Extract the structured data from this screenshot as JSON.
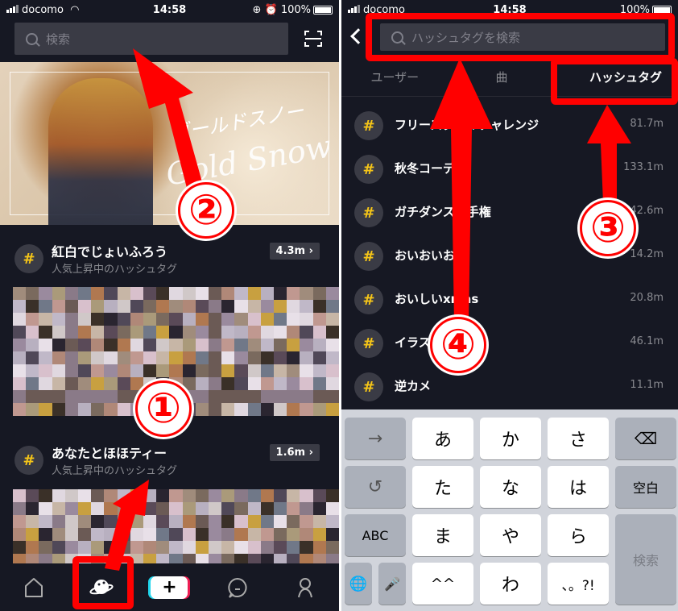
{
  "status_bar": {
    "carrier": "docomo",
    "time": "14:58",
    "battery": "100%"
  },
  "left": {
    "search": {
      "placeholder": "検索",
      "icon": "search-icon"
    },
    "scan_icon": "scan-icon",
    "banner": {
      "text_jp": "ゴールドスノー",
      "text_en": "Gold Snow"
    },
    "trending": [
      {
        "title": "紅白でじょいふろう",
        "subtitle": "人気上昇中のハッシュタグ",
        "count": "4.3m",
        "chevron": "›"
      },
      {
        "title": "あなたとほほティー",
        "subtitle": "人気上昇中のハッシュタグ",
        "count": "1.6m",
        "chevron": "›"
      }
    ],
    "tabbar": [
      {
        "name": "home",
        "icon": "home-icon"
      },
      {
        "name": "discover",
        "icon": "planet-icon"
      },
      {
        "name": "create",
        "icon": "plus-icon",
        "label": "+"
      },
      {
        "name": "inbox",
        "icon": "chat-icon"
      },
      {
        "name": "profile",
        "icon": "profile-icon"
      }
    ]
  },
  "right": {
    "search": {
      "placeholder": "ハッシュタグを検索"
    },
    "tabs": [
      {
        "label": "ユーザー",
        "active": false
      },
      {
        "label": "曲",
        "active": false
      },
      {
        "label": "ハッシュタグ",
        "active": true
      }
    ],
    "hashtags": [
      {
        "name": "フリースタイルチャレンジ",
        "visible_name": "フリース　　レンジ",
        "count": "81.7m"
      },
      {
        "name": "秋冬コーデ",
        "visible_name": "秋冬コー",
        "count": "133.1m"
      },
      {
        "name": "ガチダンス選手権",
        "visible_name": "ガチダン　選手権",
        "count": "42.6m"
      },
      {
        "name": "おいおいおい",
        "visible_name": "おいおいおい",
        "count": "14.2m"
      },
      {
        "name": "おいしいxmas",
        "visible_name": "おいしいxmas",
        "count": "20.8m"
      },
      {
        "name": "イラスト",
        "visible_name": "イラス",
        "count": "46.1m"
      },
      {
        "name": "逆カメ",
        "visible_name": "逆カメ",
        "count": "11.1m"
      }
    ],
    "keyboard": {
      "rows": [
        [
          "→",
          "あ",
          "か",
          "さ",
          "⌫"
        ],
        [
          "↺",
          "た",
          "な",
          "は",
          "空白"
        ],
        [
          "ABC",
          "ま",
          "や",
          "ら",
          "検索"
        ],
        [
          "🌐",
          "🎤",
          "^^",
          "わ",
          "、。?!"
        ]
      ],
      "search_key": "検索",
      "space_key": "空白"
    }
  },
  "hash_symbol": "#",
  "annotations": [
    {
      "number": "①",
      "target": "discover-tab"
    },
    {
      "number": "②",
      "target": "search-bar"
    },
    {
      "number": "③",
      "target": "hashtag-tab"
    },
    {
      "number": "④",
      "target": "hashtag-search-input"
    }
  ],
  "colors": {
    "background": "#161823",
    "hash_yellow": "#f5c518",
    "annotation_red": "#ff0000",
    "tiktok_cyan": "#20d5ec",
    "tiktok_pink": "#ee1d52"
  }
}
